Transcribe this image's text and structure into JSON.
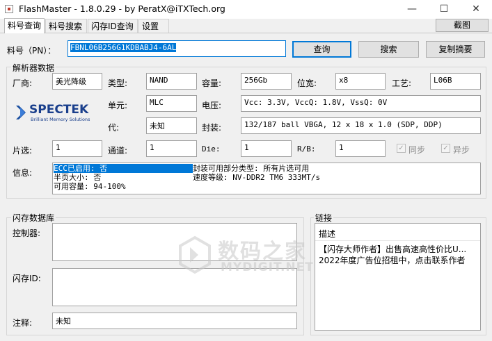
{
  "window": {
    "title": "FlashMaster - 1.8.0.29 - by PeratX@iTXTech.org",
    "minimize_glyph": "—",
    "maximize_glyph": "☐",
    "close_glyph": "✕"
  },
  "tabs": [
    "料号查询",
    "料号搜索",
    "闪存ID查询",
    "设置"
  ],
  "screenshot_button": "截图",
  "pn": {
    "label": "料号（PN）：",
    "value": "FBNL06B256G1KDBABJ4-6AL",
    "query_button": "查询",
    "search_button": "搜索",
    "copy_button": "复制摘要"
  },
  "decoder": {
    "title": "解析器数据",
    "vendor_label": "厂商:",
    "vendor_value": "美光降级",
    "type_label": "类型:",
    "type_value": "NAND",
    "capacity_label": "容量:",
    "capacity_value": "256Gb",
    "width_label": "位宽:",
    "width_value": "x8",
    "process_label": "工艺:",
    "process_value": "L06B",
    "cell_label": "单元:",
    "cell_value": "MLC",
    "voltage_label": "电压:",
    "voltage_value": "Vcc: 3.3V, VccQ: 1.8V, VssQ: 0V",
    "gen_label": "代:",
    "gen_value": "未知",
    "package_label": "封装:",
    "package_value": "132/187 ball VBGA, 12 x 18 x 1.0 (SDP, DDP)",
    "ce_label": "片选:",
    "ce_value": "1",
    "channel_label": "通道:",
    "channel_value": "1",
    "die_label": "Die:",
    "die_value": "1",
    "rb_label": "R/B:",
    "rb_value": "1",
    "sync_label": "同步",
    "async_label": "异步",
    "info_label": "信息:",
    "info_left": [
      "ECC已启用: 否",
      "半页大小: 否",
      "可用容量: 94-100%"
    ],
    "info_right": [
      "封装可用部分类型: 所有片选可用",
      "速度等级: NV-DDR2 TM6 333MT/s"
    ],
    "logo_text": "SPECTEK",
    "logo_tagline": "Brilliant Memory Solutions"
  },
  "flashdb": {
    "title": "闪存数据库",
    "controller_label": "控制器:",
    "flashid_label": "闪存ID:",
    "note_label": "注释:",
    "note_value": "未知"
  },
  "links": {
    "title": "链接",
    "header": "描述",
    "items": [
      "【闪存大师作者】出售高速高性价比U...",
      "2022年度广告位招租中，点击联系作者"
    ]
  },
  "watermark": {
    "text": "数码之家",
    "sub": "MYDIGIT.NET"
  }
}
